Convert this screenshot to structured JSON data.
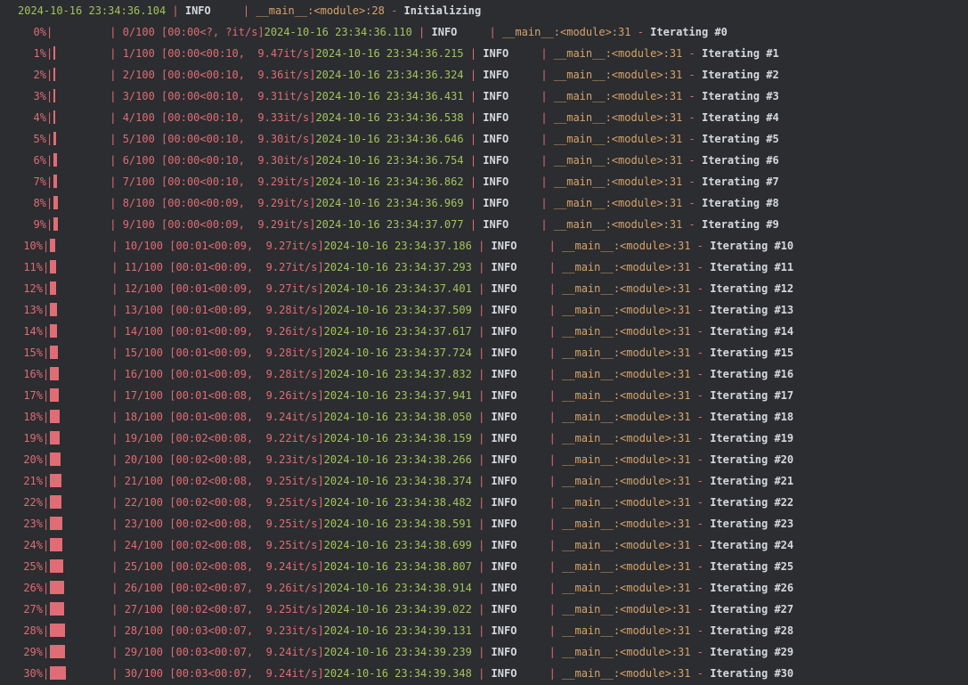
{
  "colors": {
    "background": "#2b2d30",
    "timestamp": "#a5c25c",
    "level": "#d5d8de",
    "location": "#d8a36a",
    "progress": "#e06c75",
    "message": "#d5d8de"
  },
  "log_header": {
    "timestamp": "2024-10-16 23:34:36.104",
    "level": "INFO",
    "location": "__main__:<module>:28",
    "message": "Initializing"
  },
  "progress_lines": [
    {
      "percent": "0%",
      "progress": 0.0,
      "counter": "0/100",
      "timing": "[00:00<?, ?it/s]",
      "timestamp": "2024-10-16 23:34:36.110",
      "level": "INFO",
      "location": "__main__:<module>:31",
      "message": "Iterating #0"
    },
    {
      "percent": "1%",
      "progress": 0.01,
      "counter": "1/100",
      "timing": "[00:00<00:10,  9.47it/s]",
      "timestamp": "2024-10-16 23:34:36.215",
      "level": "INFO",
      "location": "__main__:<module>:31",
      "message": "Iterating #1"
    },
    {
      "percent": "2%",
      "progress": 0.02,
      "counter": "2/100",
      "timing": "[00:00<00:10,  9.36it/s]",
      "timestamp": "2024-10-16 23:34:36.324",
      "level": "INFO",
      "location": "__main__:<module>:31",
      "message": "Iterating #2"
    },
    {
      "percent": "3%",
      "progress": 0.03,
      "counter": "3/100",
      "timing": "[00:00<00:10,  9.31it/s]",
      "timestamp": "2024-10-16 23:34:36.431",
      "level": "INFO",
      "location": "__main__:<module>:31",
      "message": "Iterating #3"
    },
    {
      "percent": "4%",
      "progress": 0.04,
      "counter": "4/100",
      "timing": "[00:00<00:10,  9.33it/s]",
      "timestamp": "2024-10-16 23:34:36.538",
      "level": "INFO",
      "location": "__main__:<module>:31",
      "message": "Iterating #4"
    },
    {
      "percent": "5%",
      "progress": 0.05,
      "counter": "5/100",
      "timing": "[00:00<00:10,  9.30it/s]",
      "timestamp": "2024-10-16 23:34:36.646",
      "level": "INFO",
      "location": "__main__:<module>:31",
      "message": "Iterating #5"
    },
    {
      "percent": "6%",
      "progress": 0.06,
      "counter": "6/100",
      "timing": "[00:00<00:10,  9.30it/s]",
      "timestamp": "2024-10-16 23:34:36.754",
      "level": "INFO",
      "location": "__main__:<module>:31",
      "message": "Iterating #6"
    },
    {
      "percent": "7%",
      "progress": 0.07,
      "counter": "7/100",
      "timing": "[00:00<00:10,  9.29it/s]",
      "timestamp": "2024-10-16 23:34:36.862",
      "level": "INFO",
      "location": "__main__:<module>:31",
      "message": "Iterating #7"
    },
    {
      "percent": "8%",
      "progress": 0.08,
      "counter": "8/100",
      "timing": "[00:00<00:09,  9.29it/s]",
      "timestamp": "2024-10-16 23:34:36.969",
      "level": "INFO",
      "location": "__main__:<module>:31",
      "message": "Iterating #8"
    },
    {
      "percent": "9%",
      "progress": 0.09,
      "counter": "9/100",
      "timing": "[00:00<00:09,  9.29it/s]",
      "timestamp": "2024-10-16 23:34:37.077",
      "level": "INFO",
      "location": "__main__:<module>:31",
      "message": "Iterating #9"
    },
    {
      "percent": "10%",
      "progress": 0.1,
      "counter": "10/100",
      "timing": "[00:01<00:09,  9.27it/s]",
      "timestamp": "2024-10-16 23:34:37.186",
      "level": "INFO",
      "location": "__main__:<module>:31",
      "message": "Iterating #10"
    },
    {
      "percent": "11%",
      "progress": 0.11,
      "counter": "11/100",
      "timing": "[00:01<00:09,  9.27it/s]",
      "timestamp": "2024-10-16 23:34:37.293",
      "level": "INFO",
      "location": "__main__:<module>:31",
      "message": "Iterating #11"
    },
    {
      "percent": "12%",
      "progress": 0.12,
      "counter": "12/100",
      "timing": "[00:01<00:09,  9.27it/s]",
      "timestamp": "2024-10-16 23:34:37.401",
      "level": "INFO",
      "location": "__main__:<module>:31",
      "message": "Iterating #12"
    },
    {
      "percent": "13%",
      "progress": 0.13,
      "counter": "13/100",
      "timing": "[00:01<00:09,  9.28it/s]",
      "timestamp": "2024-10-16 23:34:37.509",
      "level": "INFO",
      "location": "__main__:<module>:31",
      "message": "Iterating #13"
    },
    {
      "percent": "14%",
      "progress": 0.14,
      "counter": "14/100",
      "timing": "[00:01<00:09,  9.26it/s]",
      "timestamp": "2024-10-16 23:34:37.617",
      "level": "INFO",
      "location": "__main__:<module>:31",
      "message": "Iterating #14"
    },
    {
      "percent": "15%",
      "progress": 0.15,
      "counter": "15/100",
      "timing": "[00:01<00:09,  9.28it/s]",
      "timestamp": "2024-10-16 23:34:37.724",
      "level": "INFO",
      "location": "__main__:<module>:31",
      "message": "Iterating #15"
    },
    {
      "percent": "16%",
      "progress": 0.16,
      "counter": "16/100",
      "timing": "[00:01<00:09,  9.28it/s]",
      "timestamp": "2024-10-16 23:34:37.832",
      "level": "INFO",
      "location": "__main__:<module>:31",
      "message": "Iterating #16"
    },
    {
      "percent": "17%",
      "progress": 0.17,
      "counter": "17/100",
      "timing": "[00:01<00:08,  9.26it/s]",
      "timestamp": "2024-10-16 23:34:37.941",
      "level": "INFO",
      "location": "__main__:<module>:31",
      "message": "Iterating #17"
    },
    {
      "percent": "18%",
      "progress": 0.18,
      "counter": "18/100",
      "timing": "[00:01<00:08,  9.24it/s]",
      "timestamp": "2024-10-16 23:34:38.050",
      "level": "INFO",
      "location": "__main__:<module>:31",
      "message": "Iterating #18"
    },
    {
      "percent": "19%",
      "progress": 0.19,
      "counter": "19/100",
      "timing": "[00:02<00:08,  9.22it/s]",
      "timestamp": "2024-10-16 23:34:38.159",
      "level": "INFO",
      "location": "__main__:<module>:31",
      "message": "Iterating #19"
    },
    {
      "percent": "20%",
      "progress": 0.2,
      "counter": "20/100",
      "timing": "[00:02<00:08,  9.23it/s]",
      "timestamp": "2024-10-16 23:34:38.266",
      "level": "INFO",
      "location": "__main__:<module>:31",
      "message": "Iterating #20"
    },
    {
      "percent": "21%",
      "progress": 0.21,
      "counter": "21/100",
      "timing": "[00:02<00:08,  9.25it/s]",
      "timestamp": "2024-10-16 23:34:38.374",
      "level": "INFO",
      "location": "__main__:<module>:31",
      "message": "Iterating #21"
    },
    {
      "percent": "22%",
      "progress": 0.22,
      "counter": "22/100",
      "timing": "[00:02<00:08,  9.25it/s]",
      "timestamp": "2024-10-16 23:34:38.482",
      "level": "INFO",
      "location": "__main__:<module>:31",
      "message": "Iterating #22"
    },
    {
      "percent": "23%",
      "progress": 0.23,
      "counter": "23/100",
      "timing": "[00:02<00:08,  9.25it/s]",
      "timestamp": "2024-10-16 23:34:38.591",
      "level": "INFO",
      "location": "__main__:<module>:31",
      "message": "Iterating #23"
    },
    {
      "percent": "24%",
      "progress": 0.24,
      "counter": "24/100",
      "timing": "[00:02<00:08,  9.25it/s]",
      "timestamp": "2024-10-16 23:34:38.699",
      "level": "INFO",
      "location": "__main__:<module>:31",
      "message": "Iterating #24"
    },
    {
      "percent": "25%",
      "progress": 0.25,
      "counter": "25/100",
      "timing": "[00:02<00:08,  9.24it/s]",
      "timestamp": "2024-10-16 23:34:38.807",
      "level": "INFO",
      "location": "__main__:<module>:31",
      "message": "Iterating #25"
    },
    {
      "percent": "26%",
      "progress": 0.26,
      "counter": "26/100",
      "timing": "[00:02<00:07,  9.26it/s]",
      "timestamp": "2024-10-16 23:34:38.914",
      "level": "INFO",
      "location": "__main__:<module>:31",
      "message": "Iterating #26"
    },
    {
      "percent": "27%",
      "progress": 0.27,
      "counter": "27/100",
      "timing": "[00:02<00:07,  9.25it/s]",
      "timestamp": "2024-10-16 23:34:39.022",
      "level": "INFO",
      "location": "__main__:<module>:31",
      "message": "Iterating #27"
    },
    {
      "percent": "28%",
      "progress": 0.28,
      "counter": "28/100",
      "timing": "[00:03<00:07,  9.23it/s]",
      "timestamp": "2024-10-16 23:34:39.131",
      "level": "INFO",
      "location": "__main__:<module>:31",
      "message": "Iterating #28"
    },
    {
      "percent": "29%",
      "progress": 0.29,
      "counter": "29/100",
      "timing": "[00:03<00:07,  9.24it/s]",
      "timestamp": "2024-10-16 23:34:39.239",
      "level": "INFO",
      "location": "__main__:<module>:31",
      "message": "Iterating #29"
    },
    {
      "percent": "30%",
      "progress": 0.3,
      "counter": "30/100",
      "timing": "[00:03<00:07,  9.24it/s]",
      "timestamp": "2024-10-16 23:34:39.348",
      "level": "INFO",
      "location": "__main__:<module>:31",
      "message": "Iterating #30"
    }
  ]
}
